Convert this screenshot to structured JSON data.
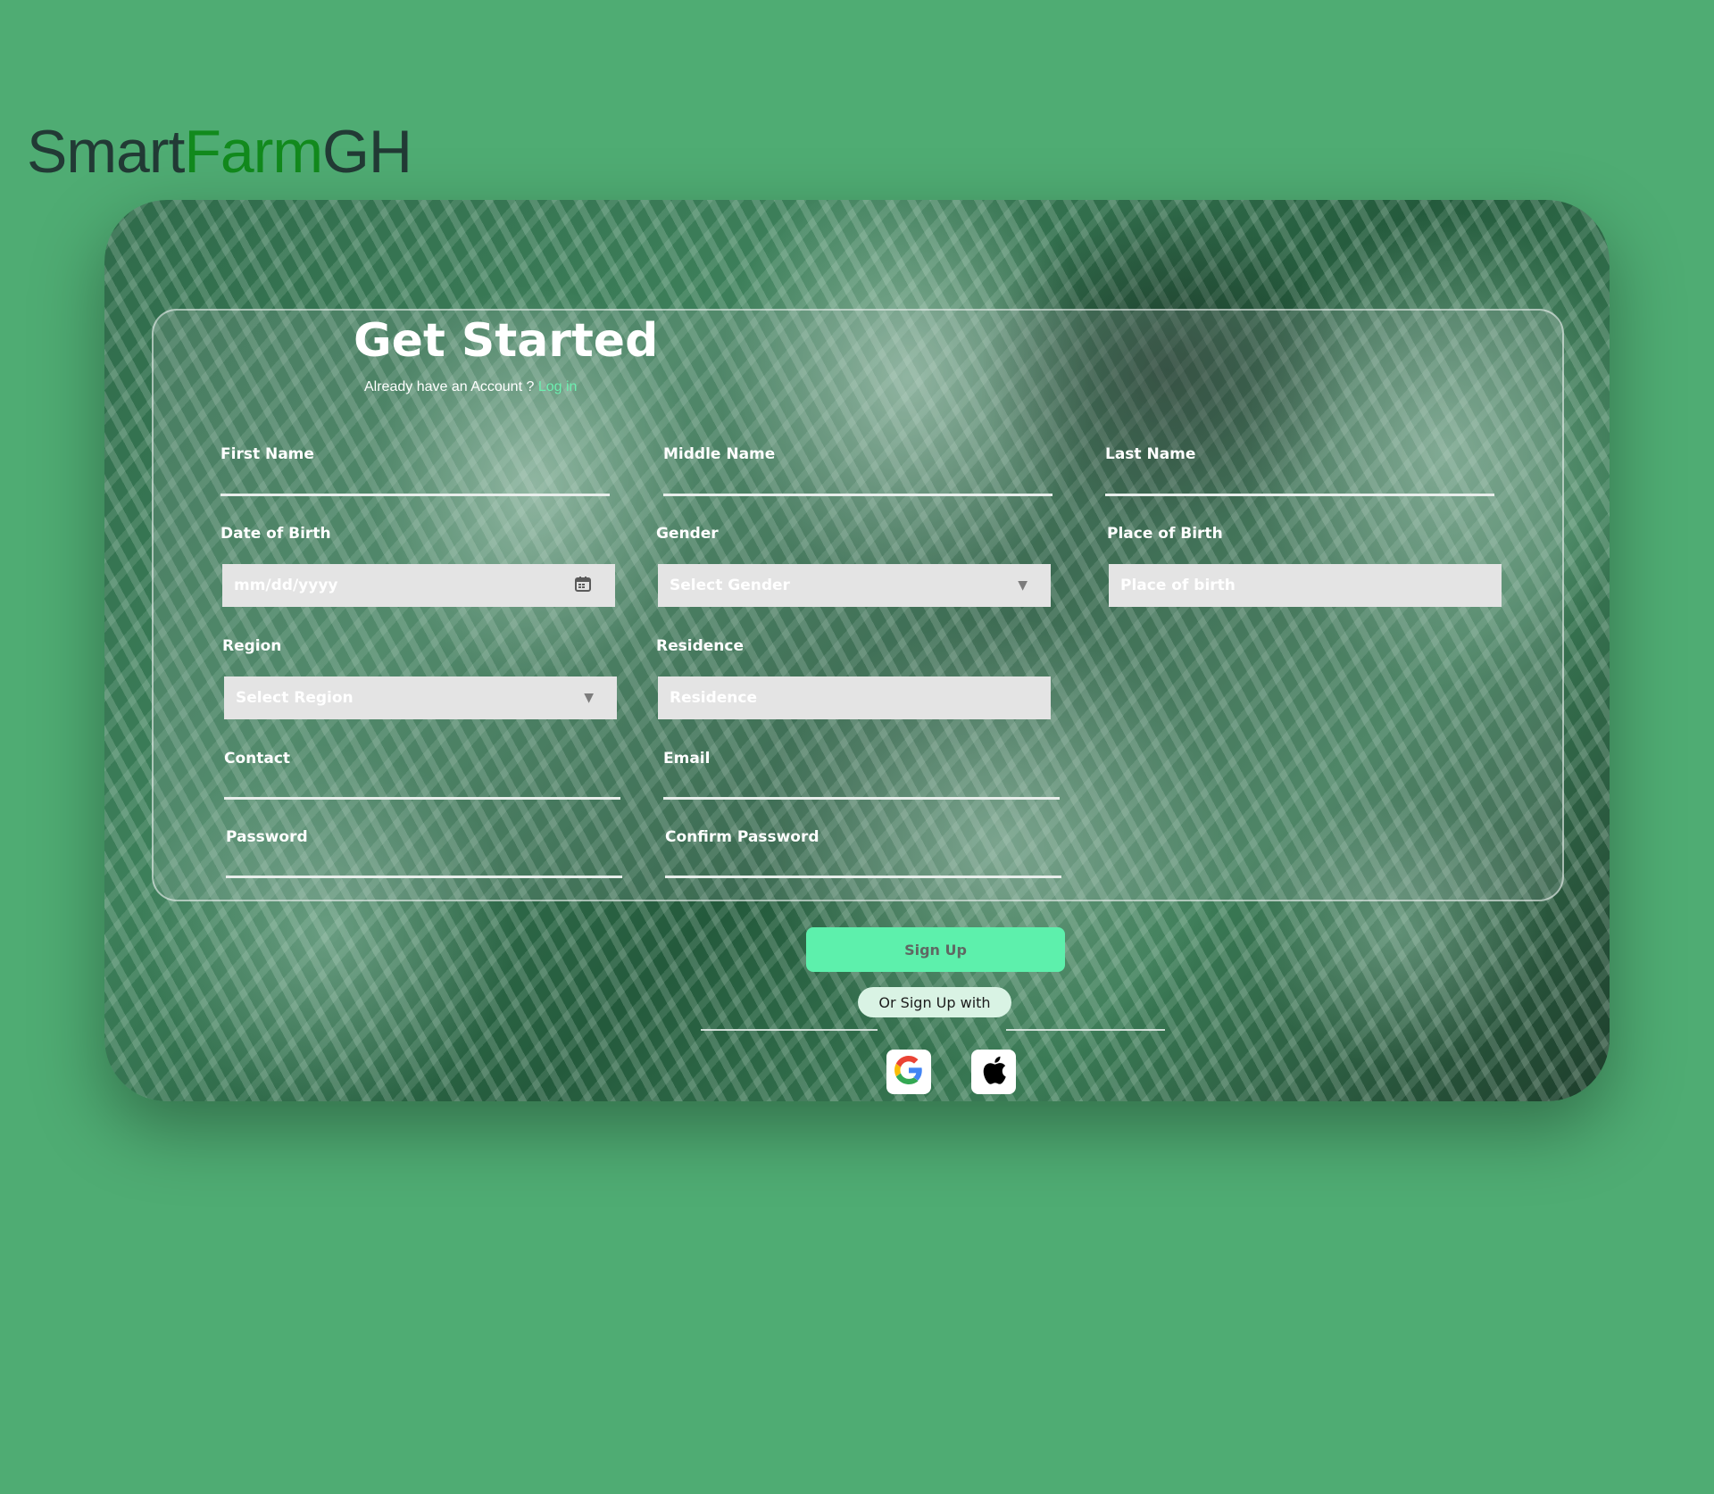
{
  "brand": {
    "part1": "Smart",
    "part2": "Farm",
    "part3": "GH"
  },
  "header": {
    "title": "Get Started",
    "subtitle": "Already have an Account ?",
    "login_link": "Log in"
  },
  "form": {
    "first_name_label": "First Name",
    "middle_name_label": "Middle Name",
    "last_name_label": "Last Name",
    "dob_label": "Date of Birth",
    "dob_placeholder": "mm/dd/yyyy",
    "gender_label": "Gender",
    "gender_placeholder": "Select Gender",
    "pob_label": "Place of Birth",
    "pob_placeholder": "Place of birth",
    "region_label": "Region",
    "region_placeholder": "Select Region",
    "residence_label": "Residence",
    "residence_placeholder": "Residence",
    "contact_label": "Contact",
    "email_label": "Email",
    "password_label": "Password",
    "confirm_password_label": "Confirm Password"
  },
  "actions": {
    "signup_label": "Sign Up",
    "alt_signup_label": "Or Sign Up with"
  },
  "icons": {
    "calendar": "calendar-icon",
    "dropdown": "triangle-down-icon",
    "google": "google-icon",
    "apple": "apple-icon"
  },
  "colors": {
    "page_background": "#4fac73",
    "brand_dark": "#223a35",
    "brand_accent": "#128a1d",
    "signup_button": "#5df0ac",
    "login_link": "#6cf0b0"
  }
}
